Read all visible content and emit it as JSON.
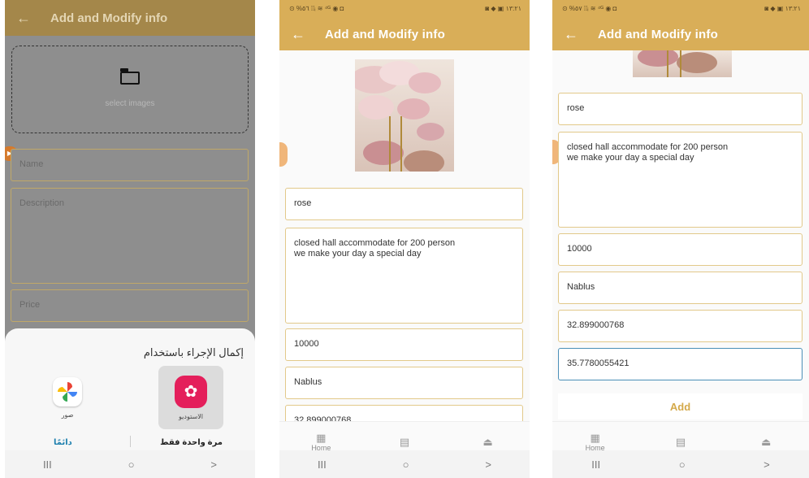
{
  "colors": {
    "accent": "#d9ae58",
    "field_border": "#e2c98a",
    "focus": "#4a8fb7",
    "add_text": "#d4a94a"
  },
  "app": {
    "title": "Add and Modify info",
    "back_icon": "arrow-left-icon"
  },
  "status": {
    "left": "⊙ %٥٦ ⁞⁞ᵢ ≋ ⁴ᴳ ◉ ◘",
    "right": "◙ ◆ ▣ ١٣:٢١"
  },
  "status3": {
    "left": "⊙ %٥٧ ⁞⁞ᵢ ≋ ⁴ᴳ ◉ ◘",
    "right": "◙ ◆ ▣ ١٣:٢١"
  },
  "screen1": {
    "select_images": "select images",
    "placeholders": {
      "name": "Name",
      "description": "Description",
      "price": "Price"
    },
    "sheet": {
      "title": "إكمال الإجراء باستخدام",
      "apps": [
        {
          "label": "الاستوديو"
        },
        {
          "label": "صور"
        }
      ],
      "always": "دائمًا",
      "just_once": "مرة واحدة فقط"
    }
  },
  "form": {
    "name": "rose",
    "description": "closed hall accommodate for 200 person\nwe make your day a special day",
    "price": "10000",
    "city": "Nablus",
    "latitude": "32.899000768",
    "latitude_clipped": "32 899000768",
    "longitude": "35.7780055421",
    "add_button": "Add"
  },
  "nav": {
    "home": "Home",
    "home_icon": "grid-icon",
    "chat_icon": "chat-icon",
    "profile_icon": "person-icon"
  },
  "sysnav": {
    "recent": "III",
    "home": "○",
    "back": ">"
  }
}
